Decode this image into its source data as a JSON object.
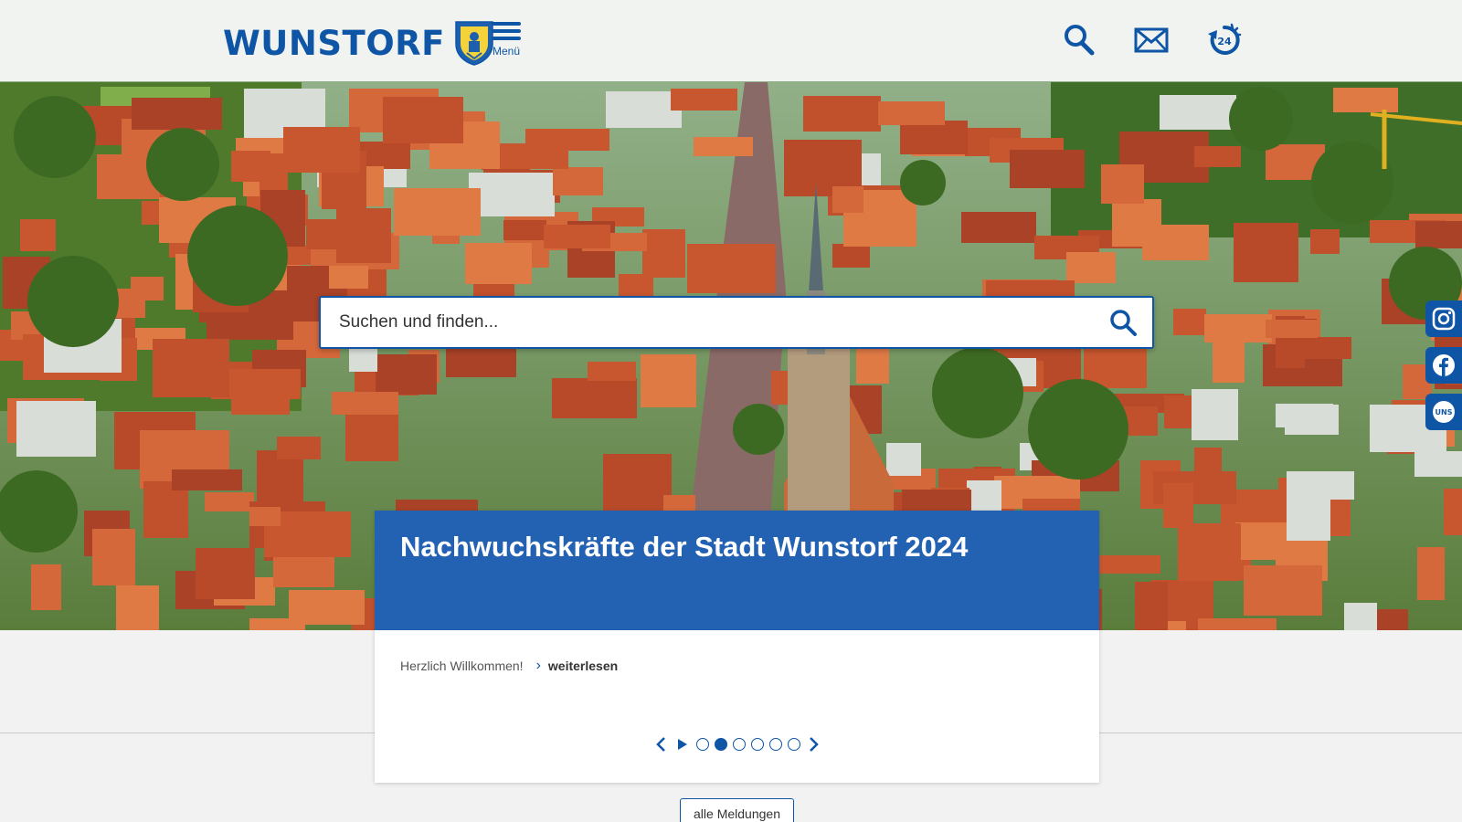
{
  "header": {
    "logo_text": "WUNSTORF",
    "menu_label": "Menü",
    "icons": [
      "search-icon",
      "mail-icon",
      "24h-service-icon"
    ]
  },
  "search": {
    "placeholder": "Suchen und finden..."
  },
  "social": [
    "instagram-icon",
    "facebook-icon",
    "uns-app-icon"
  ],
  "news": {
    "title": "Nachwuchskräfte der Stadt Wunstorf 2024",
    "teaser": "Herzlich Willkommen!",
    "read_more": "weiterlesen",
    "slides_total": 6,
    "active_slide": 2
  },
  "all_news_label": "alle Meldungen",
  "colors": {
    "brand_blue": "#0f55a6",
    "banner_blue": "#1255ac"
  }
}
